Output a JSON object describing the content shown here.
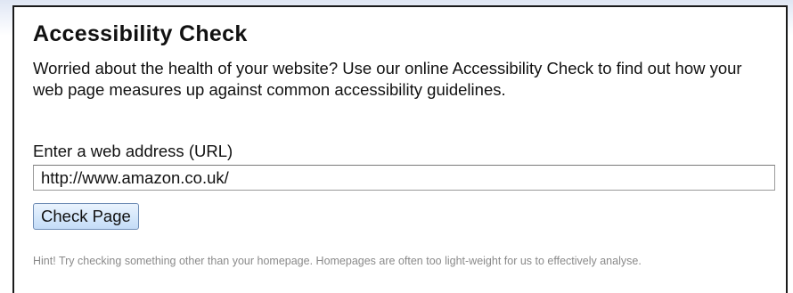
{
  "accessibility_check": {
    "title": "Accessibility Check",
    "intro": "Worried about the health of your website? Use our online Accessibility Check to find out how your web page measures up against common accessibility guidelines.",
    "url_label": "Enter a web address (URL)",
    "url_value": "http://www.amazon.co.uk/",
    "check_button_label": "Check Page",
    "hint": "Hint! Try checking something other than your homepage. Homepages are often too light-weight for us to effectively analyse."
  }
}
